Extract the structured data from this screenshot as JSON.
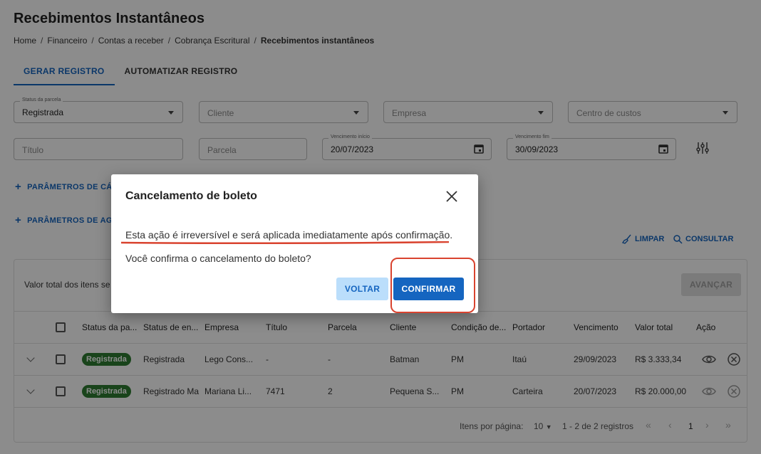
{
  "page": {
    "title": "Recebimentos Instantâneos",
    "breadcrumb": [
      "Home",
      "Financeiro",
      "Contas a receber",
      "Cobrança Escritural",
      "Recebimentos instantâneos"
    ]
  },
  "tabs": [
    {
      "label": "GERAR REGISTRO",
      "active": true
    },
    {
      "label": "AUTOMATIZAR REGISTRO",
      "active": false
    }
  ],
  "filters": {
    "status_parcela": {
      "label": "Status da parcela",
      "value": "Registrada"
    },
    "cliente": {
      "placeholder": "Cliente"
    },
    "empresa": {
      "placeholder": "Empresa"
    },
    "centro_custos": {
      "placeholder": "Centro de custos"
    },
    "titulo": {
      "placeholder": "Título"
    },
    "parcela": {
      "placeholder": "Parcela"
    },
    "vencimento_inicio": {
      "label": "Vencimento início",
      "value": "20/07/2023"
    },
    "vencimento_fim": {
      "label": "Vencimento fim",
      "value": "30/09/2023"
    }
  },
  "params": {
    "param1": "PARÂMETROS DE CÁ",
    "param2": "PARÂMETROS DE AG"
  },
  "actions": {
    "limpar": "LIMPAR",
    "consultar": "CONSULTAR"
  },
  "table": {
    "total_label": "Valor total dos itens se",
    "avancar": "AVANÇAR",
    "headers": [
      "Status da pa...",
      "Status de en...",
      "Empresa",
      "Título",
      "Parcela",
      "Cliente",
      "Condição de...",
      "Portador",
      "Vencimento",
      "Valor total",
      "Ação"
    ],
    "rows": [
      {
        "status": "Registrada",
        "status_envio": "Registrada",
        "empresa": "Lego Cons...",
        "titulo": "-",
        "parcela": "-",
        "cliente": "Batman",
        "condicao": "PM",
        "portador": "Itaú",
        "vencimento": "29/09/2023",
        "valor": "R$ 3.333,34"
      },
      {
        "status": "Registrada",
        "status_envio": "Registrado Ma",
        "empresa": "Mariana Li...",
        "titulo": "7471",
        "parcela": "2",
        "cliente": "Pequena S...",
        "condicao": "PM",
        "portador": "Carteira",
        "vencimento": "20/07/2023",
        "valor": "R$ 20.000,00"
      }
    ],
    "pager": {
      "items_per_page_label": "Itens por página:",
      "items_per_page": "10",
      "range": "1 - 2 de 2 registros",
      "current_page": "1"
    }
  },
  "dialog": {
    "title": "Cancelamento de boleto",
    "message": "Esta ação é irreversível e será aplicada imediatamente após confirmação.",
    "question": "Você confirma o cancelamento do boleto?",
    "voltar": "VOLTAR",
    "confirmar": "CONFIRMAR"
  },
  "colors": {
    "primary": "#1565c0",
    "badge": "#2e7d32",
    "annotation": "#d9432f"
  }
}
